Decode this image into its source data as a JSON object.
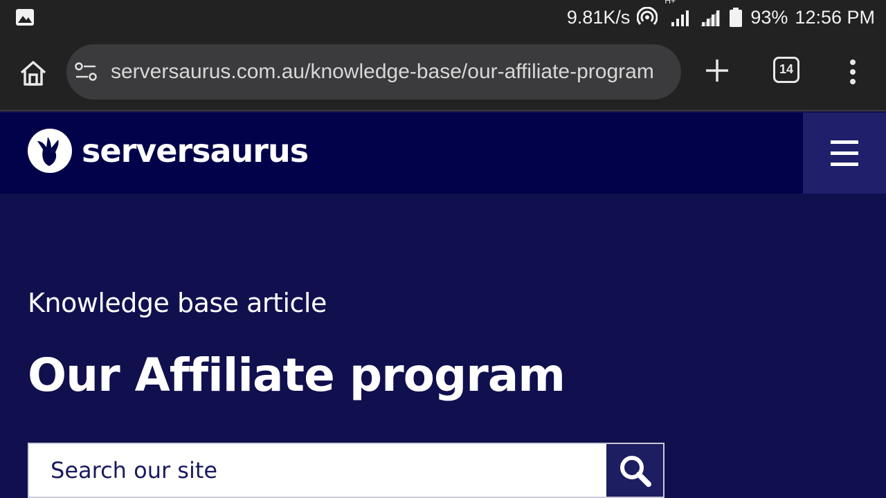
{
  "status_bar": {
    "net_speed": "9.81K/s",
    "network_type": "H+",
    "battery": "93%",
    "time": "12:56 PM",
    "icons": [
      "image-icon",
      "hotspot-icon",
      "signal-icon",
      "signal-icon",
      "battery-icon"
    ]
  },
  "browser": {
    "url": "serversaurus.com.au/knowledge-base/our-affiliate-program",
    "tab_count": "14",
    "icons": [
      "home-icon",
      "tune-icon",
      "plus-icon",
      "tabs-icon",
      "more-vert-icon"
    ]
  },
  "site": {
    "logo_text": "serversaurus",
    "header_color": "#02024a",
    "hero_color": "#10104f"
  },
  "hero": {
    "kicker": "Knowledge base article",
    "title": "Our Affiliate program"
  },
  "search": {
    "placeholder": "Search our site"
  }
}
